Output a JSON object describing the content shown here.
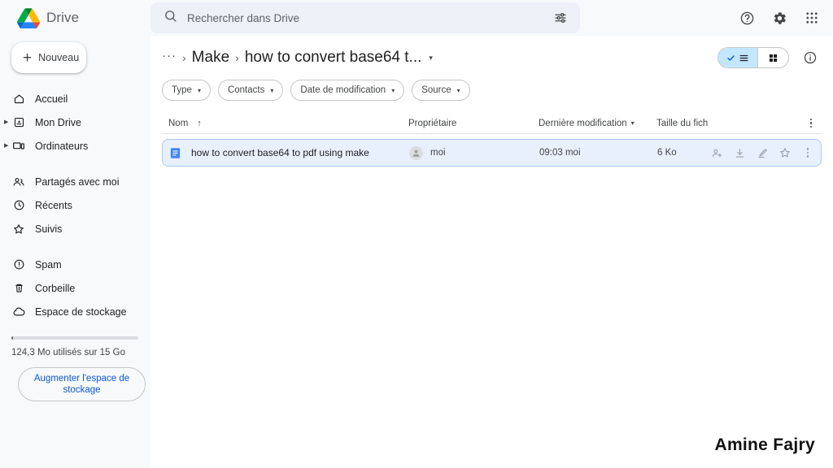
{
  "topbar": {
    "brand": "Drive",
    "logo_icon": "google-drive-logo",
    "search": {
      "placeholder": "Rechercher dans Drive",
      "value": "",
      "search_icon": "search-icon",
      "tune_icon": "tune-filter-icon"
    },
    "help_icon": "help-circle-icon",
    "settings_icon": "gear-icon",
    "apps_icon": "apps-grid-icon"
  },
  "sidebar": {
    "new_button": {
      "label": "Nouveau",
      "icon": "plus-icon"
    },
    "items": [
      {
        "label": "Accueil",
        "icon": "home-icon",
        "expandable": false
      },
      {
        "label": "Mon Drive",
        "icon": "drive-icon",
        "expandable": true
      },
      {
        "label": "Ordinateurs",
        "icon": "computer-icon",
        "expandable": true
      },
      {
        "label": "Partagés avec moi",
        "icon": "people-icon",
        "expandable": false
      },
      {
        "label": "Récents",
        "icon": "clock-icon",
        "expandable": false
      },
      {
        "label": "Suivis",
        "icon": "star-icon",
        "expandable": false
      },
      {
        "label": "Spam",
        "icon": "alert-circle-icon",
        "expandable": false
      },
      {
        "label": "Corbeille",
        "icon": "trash-icon",
        "expandable": false
      },
      {
        "label": "Espace de stockage",
        "icon": "cloud-icon",
        "expandable": false
      }
    ],
    "storage": {
      "text": "124,3 Mo utilisés sur 15 Go",
      "percent": 1,
      "upgrade_label": "Augmenter l'espace de stockage",
      "accent": "#0b57d0"
    }
  },
  "main": {
    "breadcrumb": {
      "overflow": "···",
      "separator": "›",
      "items": [
        "Make"
      ],
      "current": "how to convert base64 t...",
      "caret": "▾"
    },
    "view_toggle": {
      "list_label": "list-view",
      "grid_label": "grid-view",
      "active": "list",
      "check_icon": "check-icon"
    },
    "info_icon": "info-circle-icon",
    "filters": [
      {
        "label": "Type",
        "caret": "▾"
      },
      {
        "label": "Contacts",
        "caret": "▾"
      },
      {
        "label": "Date de modification",
        "caret": "▾"
      },
      {
        "label": "Source",
        "caret": "▾"
      }
    ],
    "table": {
      "columns": {
        "name": "Nom",
        "name_sort": "↑",
        "owner": "Propriétaire",
        "modified": "Dernière modification",
        "modified_sort": "▾",
        "size": "Taille du fich",
        "more_icon": "kebab-menu-icon"
      },
      "rows": [
        {
          "icon": "google-docs-icon",
          "name": "how to convert base64 to pdf using make",
          "owner": "moi",
          "owner_avatar": "person-avatar",
          "modified": "09:03 moi",
          "size": "6 Ko",
          "selected": true,
          "actions": [
            "add-person-icon",
            "download-icon",
            "edit-pencil-icon",
            "star-outline-icon",
            "kebab-menu-icon"
          ]
        }
      ]
    }
  },
  "watermark": {
    "text": "Amine Fajry"
  }
}
